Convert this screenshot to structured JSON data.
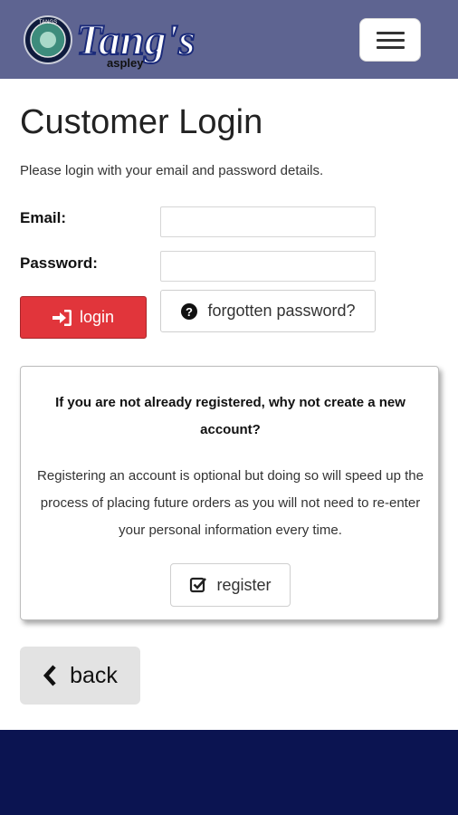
{
  "header": {
    "logo_text": "Tang's",
    "logo_subtext": "aspley",
    "logo_badge_text": "TANGS",
    "menu_icon": "hamburger-menu-icon",
    "colors": {
      "header_bg": "#5e6491"
    }
  },
  "page": {
    "title": "Customer Login",
    "intro": "Please login with your email and password details."
  },
  "login_form": {
    "email_label": "Email:",
    "email_value": "",
    "password_label": "Password:",
    "password_value": "",
    "login_button": {
      "label": "login",
      "icon": "sign-in-icon"
    },
    "forgot_button": {
      "label": "forgotten password?",
      "icon": "question-circle-icon"
    },
    "colors": {
      "login_bg": "#e1353b"
    }
  },
  "register_card": {
    "heading": "If you are not already registered, why not create a new account?",
    "body": "Registering an account is optional but doing so will speed up the process of placing future orders as you will not need to re-enter your personal information every time.",
    "register_button": {
      "label": "register",
      "icon": "check-square-icon"
    }
  },
  "back_button": {
    "label": "back",
    "icon": "chevron-left-icon"
  },
  "footer": {
    "colors": {
      "footer_bg": "#0b1451"
    }
  }
}
